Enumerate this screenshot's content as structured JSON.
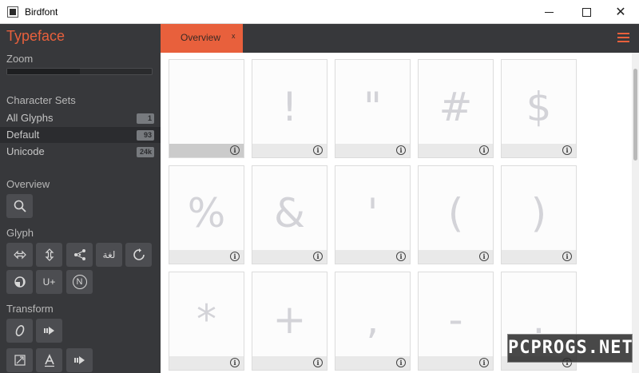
{
  "window": {
    "title": "Birdfont",
    "min_glyph": "",
    "close_glyph": "✕"
  },
  "sidebar": {
    "title": "Typeface",
    "zoom_label": "Zoom",
    "zoom_level": 0.5,
    "character_sets_label": "Character Sets",
    "sets": [
      {
        "label": "All Glyphs",
        "count": "1",
        "active": false
      },
      {
        "label": "Default",
        "count": "93",
        "active": true
      },
      {
        "label": "Unicode",
        "count": "24k",
        "active": false
      }
    ],
    "overview_label": "Overview",
    "glyph_label": "Glyph",
    "glyph_tools": [
      "flip-horizontal-icon",
      "flip-vertical-icon",
      "share-points-icon",
      "arabic-text-icon",
      "rotate-icon",
      "fill-icon",
      "unicode-icon",
      "n-circle-icon"
    ],
    "glyph_tool_text": {
      "arabic": "لغة",
      "unicode": "U+",
      "n": "N"
    },
    "transform_label": "Transform",
    "transform_tools": [
      "oval-icon",
      "arrow-right-icon",
      "resize-icon",
      "text-a-icon",
      "arrow-right-icon-2"
    ]
  },
  "tabs": [
    {
      "label": "Overview",
      "close": "x"
    }
  ],
  "glyphs": [
    " ",
    "!",
    "\"",
    "#",
    "$",
    "%",
    "&",
    "'",
    "(",
    ")",
    "*",
    "+",
    ",",
    "-",
    "."
  ],
  "info_glyph": "i",
  "watermark": "PCPROGS.NET",
  "colors": {
    "accent": "#e8603c",
    "sidebar": "#37383b",
    "glyph": "#d3d3d8"
  }
}
